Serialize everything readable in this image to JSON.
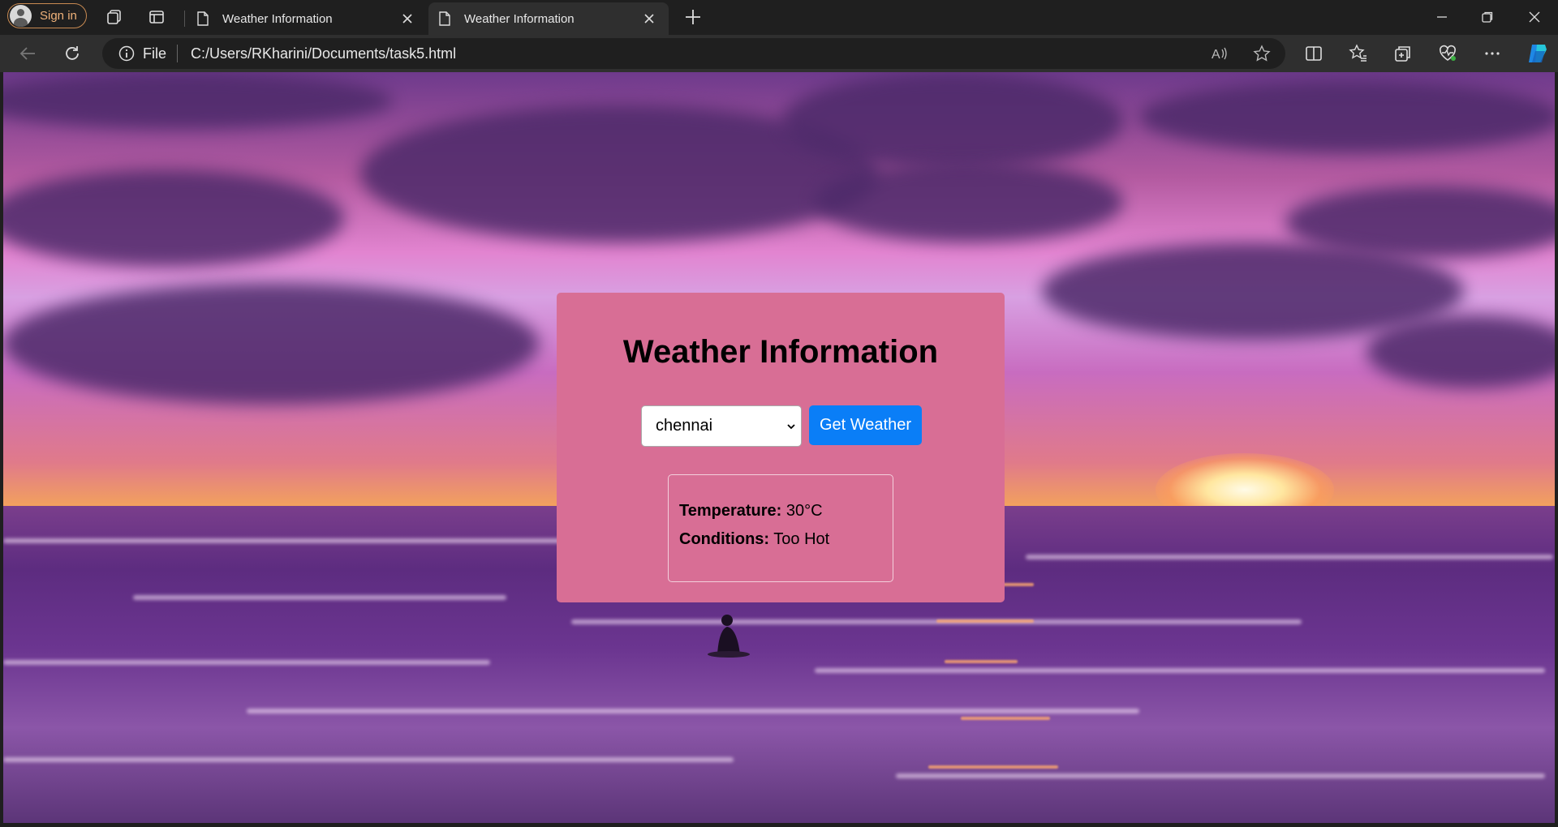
{
  "browser": {
    "sign_in_label": "Sign in",
    "tabs": [
      {
        "title": "Weather Information",
        "active": false
      },
      {
        "title": "Weather Information",
        "active": true
      }
    ],
    "address": {
      "scheme_label": "File",
      "url": "C:/Users/RKharini/Documents/task5.html"
    },
    "accent_color": "#f0b27a"
  },
  "page": {
    "heading": "Weather Information",
    "city_select": {
      "selected": "chennai"
    },
    "get_weather_label": "Get Weather",
    "result": {
      "temperature_label": "Temperature:",
      "temperature_value": "30°C",
      "conditions_label": "Conditions:",
      "conditions_value": "Too Hot"
    },
    "colors": {
      "card_background": "#d86e95",
      "button_background": "#0a7ef7"
    }
  }
}
